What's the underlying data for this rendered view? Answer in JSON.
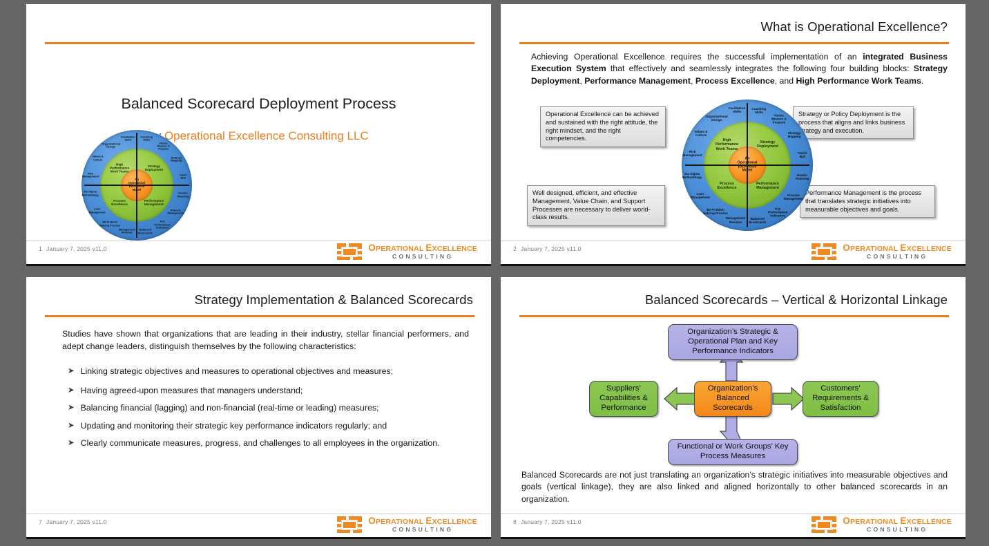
{
  "meta": {
    "footer_date": "January 7, 2025 v11.0",
    "logo": {
      "line1_a": "O",
      "line1_b": "PERATIONAL ",
      "line1_c": "E",
      "line1_d": "XCELLENCE",
      "line2": "CONSULTING"
    },
    "accent_color": "#ED7D1B",
    "page_background": "#656565"
  },
  "wheel": {
    "core": "An\nOperational\nExcellence\nModel",
    "quadrants": [
      "High\nPerformance\nWork Teams",
      "Strategy\nDeployment",
      "Performance\nManagement",
      "Process\nExcellence"
    ],
    "outer": [
      "Coaching\nSkills",
      "Vision,\nMission &\nPurpose",
      "Strategy\nMapping",
      "Catch\nBall",
      "Hoshin\nPlanning",
      "Process\nManagement",
      "Key\nPerformance\nIndicators",
      "Balanced\nScorecards",
      "Management\nReviews",
      "8D Problem\nSolving Process",
      "Lean\nManagement",
      "Six Sigma\nMethodology",
      "Risk\nManagement",
      "Values &\nCulture",
      "Organizational\nDesign",
      "Facilitation\nSkills"
    ]
  },
  "slide1": {
    "number": "1",
    "title": "Balanced Scorecard Deployment Process",
    "by_prefix": "by ",
    "by_company": "Operational Excellence Consulting LLC"
  },
  "slide2": {
    "number": "2",
    "title": "What is Operational Excellence?",
    "paragraph_parts": [
      {
        "text": "Achieving Operational Excellence requires the successful implementation of an ",
        "bold": false
      },
      {
        "text": "integrated Business Execution System",
        "bold": true
      },
      {
        "text": " that effectively and seamlessly integrates the following four building blocks: ",
        "bold": false
      },
      {
        "text": "Strategy Deployment",
        "bold": true
      },
      {
        "text": ", ",
        "bold": false
      },
      {
        "text": "Performance Management",
        "bold": true
      },
      {
        "text": ", ",
        "bold": false
      },
      {
        "text": "Process Excellence",
        "bold": true
      },
      {
        "text": ", and ",
        "bold": false
      },
      {
        "text": "High Performance Work Teams",
        "bold": true
      },
      {
        "text": ".",
        "bold": false
      }
    ],
    "callouts": {
      "top_left": "Operational Excellence can be achieved and sustained with the right attitude, the right mindset, and the right competencies.",
      "top_right": "Strategy or Policy Deployment is the process that aligns and links business strategy and execution.",
      "bottom_left": "Well designed, efficient, and effective Management, Value Chain, and Support Processes are necessary to deliver world-class results.",
      "bottom_right": "Performance Management is the process that translates strategic initiatives into measurable objectives and goals."
    }
  },
  "slide3": {
    "number": "7",
    "title": "Strategy Implementation & Balanced Scorecards",
    "intro": "Studies have shown that organizations that are leading in their industry, stellar financial performers, and adept change leaders, distinguish themselves by the following characteristics:",
    "bullet_glyph": "➤",
    "bullets": [
      "Linking strategic objectives and measures to operational objectives and measures;",
      "Having agreed-upon measures that managers understand;",
      "Balancing financial (lagging) and non-financial (real-time or leading) measures;",
      "Updating and monitoring their strategic key performance indicators regularly; and",
      "Clearly communicate measures, progress, and challenges to all employees in the organization."
    ]
  },
  "slide4": {
    "number": "8",
    "title": "Balanced Scorecards – Vertical & Horizontal Linkage",
    "diagram": {
      "top": "Organization’s Strategic & Operational Plan and Key Performance Indicators",
      "left": "Suppliers’ Capabilities & Performance",
      "center": "Organization’s Balanced Scorecards",
      "right": "Customers’ Requirements & Satisfaction",
      "bottom": "Functional or Work Groups’ Key Process Measures",
      "colors": {
        "vertical": "#b0ace5",
        "horizontal": "#8cc653",
        "center": "#F4881B"
      }
    },
    "caption": "Balanced Scorecards are not just translating an organization’s strategic initiatives into measurable objectives and goals (vertical linkage), they are also linked and aligned horizontally to other balanced scorecards in an organization."
  }
}
